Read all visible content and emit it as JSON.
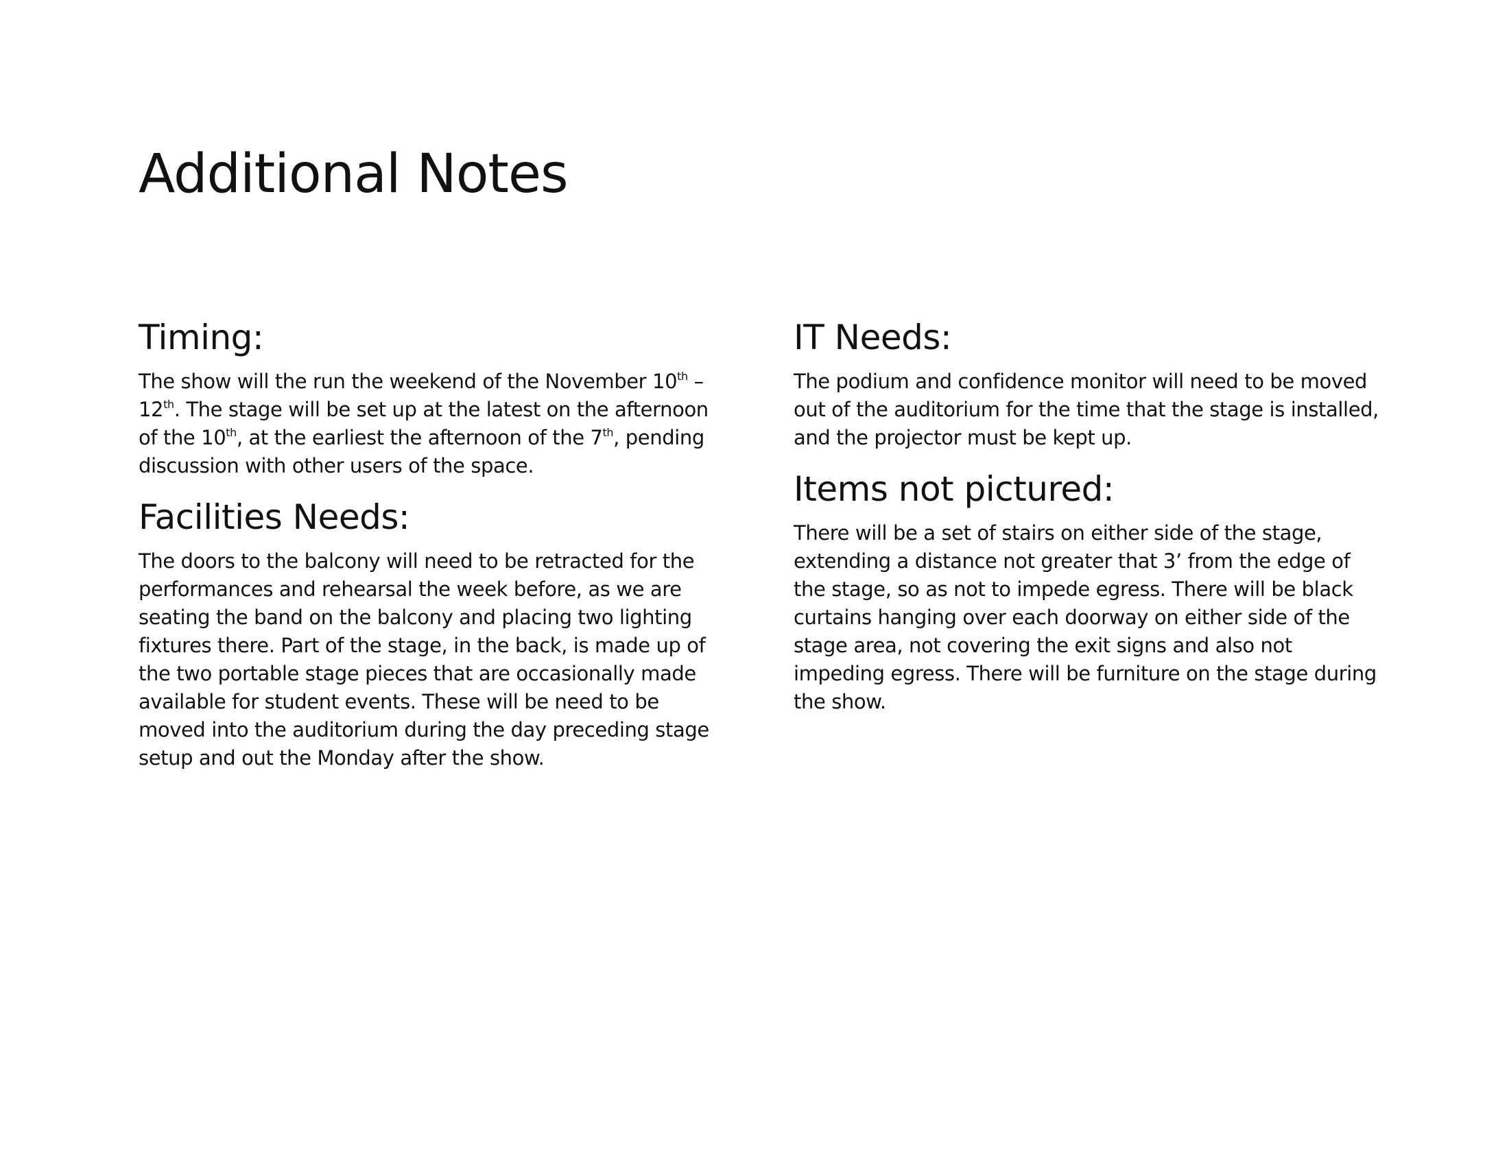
{
  "title": "Additional Notes",
  "sections": {
    "timing": {
      "heading": "Timing:",
      "b1": "The show will the run the weekend of the November 10",
      "s1": "th",
      "b2": " – 12",
      "s2": "th",
      "b3": ". The stage will be set up at the latest on the afternoon of the 10",
      "s3": "th",
      "b4": ", at the earliest the afternoon of the 7",
      "s4": "th",
      "b5": ", pending discussion with other users of the space."
    },
    "facilities": {
      "heading": "Facilities Needs:",
      "body": "The doors to the balcony will need to be retracted for the performances and rehearsal the week before, as we are seating the band on the balcony and placing two lighting fixtures there. Part of the stage, in the back, is made up of the two portable stage pieces that are occasionally made available for student events. These will be need to be moved into the auditorium during the day preceding stage setup and out the Monday after the show."
    },
    "it": {
      "heading": "IT Needs:",
      "body": "The podium and confidence monitor will need to be moved out of the auditorium for the time that the stage is installed, and the projector must be kept up."
    },
    "items": {
      "heading": "Items not pictured:",
      "body": "There will be a set of stairs on either side of the stage, extending a distance not greater that 3’ from the edge of the stage, so as not to impede egress. There will be black curtains hanging over each doorway on either side of the stage area, not covering the exit signs and also not impeding egress. There will be furniture on the stage during the show."
    }
  }
}
